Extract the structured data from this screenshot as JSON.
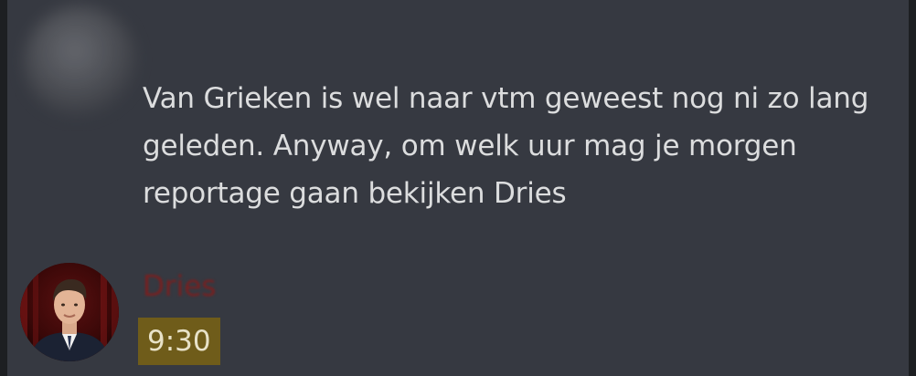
{
  "previous_message": {
    "text": "Van Grieken is wel naar vtm geweest nog ni zo lang geleden. Anyway, om welk uur mag je morgen reportage gaan bekijken Dries"
  },
  "reply": {
    "author": "Dries",
    "text": "9:30",
    "author_color": "#7a1f1f",
    "highlight_color": "#6f5c1a"
  },
  "colors": {
    "background": "#363941",
    "text": "#dcddde"
  }
}
